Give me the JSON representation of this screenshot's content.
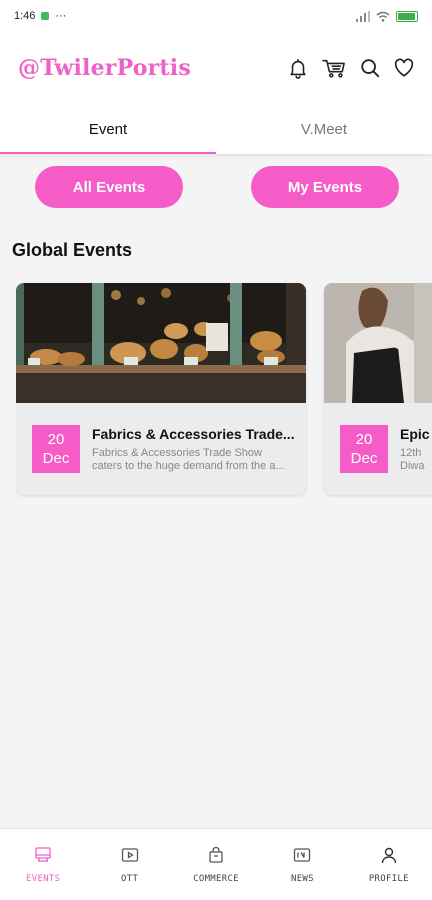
{
  "status_bar": {
    "time": "1:46",
    "dots": "···",
    "battery_level": 0.85,
    "colors": {
      "indicator": "#3cc15a",
      "battery": "#3cae4c"
    }
  },
  "header": {
    "brand": "@TwilerPortis",
    "icons": [
      "bell-icon",
      "cart-icon",
      "search-icon",
      "heart-icon"
    ]
  },
  "tabs": [
    {
      "label": "Event",
      "active": true
    },
    {
      "label": "V.Meet",
      "active": false
    }
  ],
  "filters": {
    "all_events": "All Events",
    "my_events": "My Events"
  },
  "section": {
    "title": "Global Events"
  },
  "events": [
    {
      "day": "20",
      "month": "Dec",
      "title": "Fabrics & Accessories Trade...",
      "desc_line1": "Fabrics & Accessories Trade Show",
      "desc_line2": "caters to the huge demand from the a...",
      "image": "bakery-display-image"
    },
    {
      "day": "20",
      "month": "Dec",
      "title": "Epic",
      "desc_line1": "12th",
      "desc_line2": "Diwa",
      "image": "person-apron-image"
    }
  ],
  "bottom_nav": [
    {
      "label": "EVENTS",
      "icon": "events-icon",
      "active": true
    },
    {
      "label": "OTT",
      "icon": "ott-icon",
      "active": false
    },
    {
      "label": "COMMERCE",
      "icon": "commerce-icon",
      "active": false
    },
    {
      "label": "NEWS",
      "icon": "news-icon",
      "active": false
    },
    {
      "label": "PROFILE",
      "icon": "profile-icon",
      "active": false
    }
  ],
  "colors": {
    "accent": "#f55cc8",
    "brand": "#f060c8",
    "background": "#f4f4f5"
  }
}
